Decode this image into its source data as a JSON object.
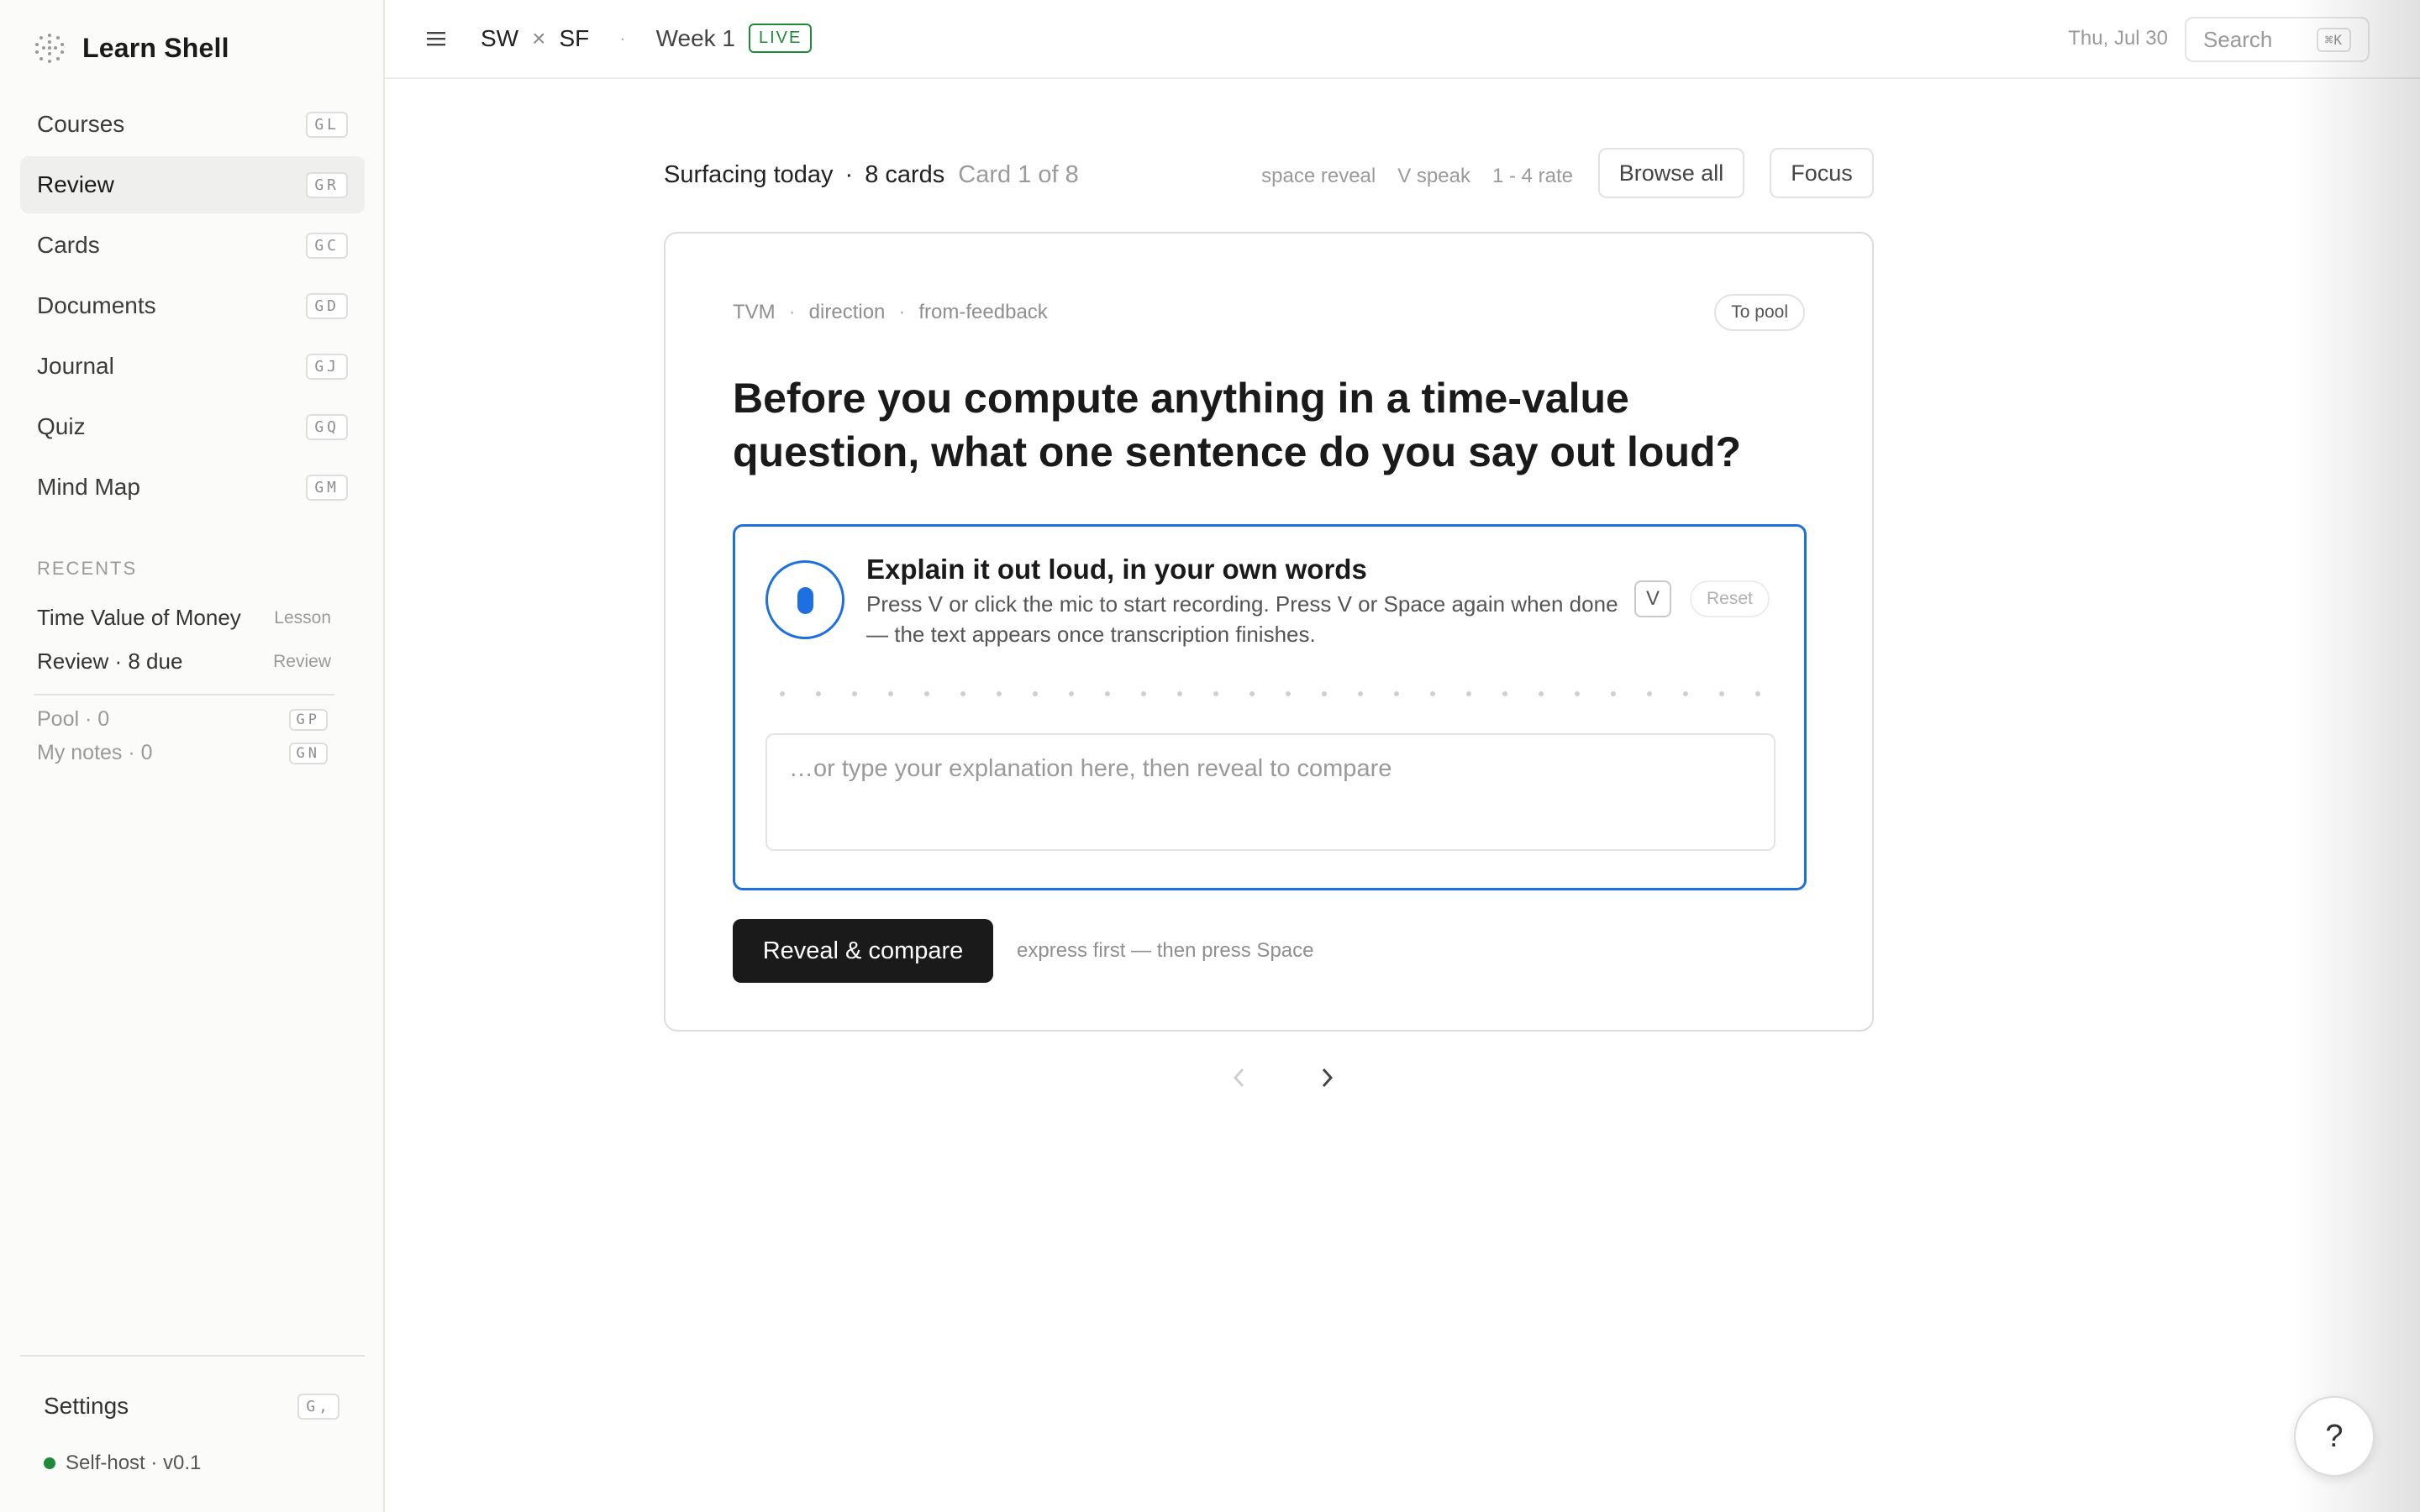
{
  "brand": {
    "name": "Learn Shell",
    "logo_icon": "dotted-circle-icon"
  },
  "sidebar": {
    "items": [
      {
        "label": "Courses",
        "shortcut": "GL"
      },
      {
        "label": "Review",
        "shortcut": "GR",
        "active": true
      },
      {
        "label": "Cards",
        "shortcut": "GC"
      },
      {
        "label": "Documents",
        "shortcut": "GD"
      },
      {
        "label": "Journal",
        "shortcut": "GJ"
      },
      {
        "label": "Quiz",
        "shortcut": "GQ"
      },
      {
        "label": "Mind Map",
        "shortcut": "GM"
      }
    ],
    "recents_label": "RECENTS",
    "recents": [
      {
        "label": "Time Value of Money",
        "tag": "Lesson"
      },
      {
        "label": "Review · 8 due",
        "tag": "Review"
      }
    ],
    "small": [
      {
        "label": "Pool · 0",
        "shortcut": "GP"
      },
      {
        "label": "My notes · 0",
        "shortcut": "GN"
      }
    ],
    "settings": {
      "label": "Settings",
      "shortcut": "G,"
    },
    "status": {
      "label": "Self-host · v0.1",
      "color": "#1e8a3a"
    }
  },
  "topbar": {
    "crumb_a": "SW",
    "crumb_x": "×",
    "crumb_b": "SF",
    "dot": "·",
    "week": "Week 1",
    "live": "LIVE",
    "date": "Thu, Jul 30",
    "search_label": "Search",
    "search_shortcut": "⌘K"
  },
  "review": {
    "title": "Surfacing today",
    "bullet": "·",
    "count": "8 cards",
    "position": "Card 1 of 8",
    "hints": [
      "space reveal",
      "V speak",
      "1 - 4 rate"
    ],
    "browse_label": "Browse all",
    "focus_label": "Focus"
  },
  "card": {
    "tags": [
      "TVM",
      "direction",
      "from-feedback"
    ],
    "tag_sep": "·",
    "pool_label": "To pool",
    "question": "Before you compute anything in a time-value question, what one sentence do you say out loud?",
    "speak_title": "Explain it out loud, in your own words",
    "speak_desc": "Press V or click the mic to start recording. Press V or Space again when done — the text appears once transcription finishes.",
    "v_key": "V",
    "reset_label": "Reset",
    "answer_placeholder": "…or type your explanation here, then reveal to compare",
    "reveal_label": "Reveal & compare",
    "reveal_hint": "express first — then press Space"
  },
  "help": {
    "label": "?"
  },
  "colors": {
    "accent": "#1e6fe0",
    "live": "#1e8a3a",
    "dark": "#1a1a1a"
  }
}
